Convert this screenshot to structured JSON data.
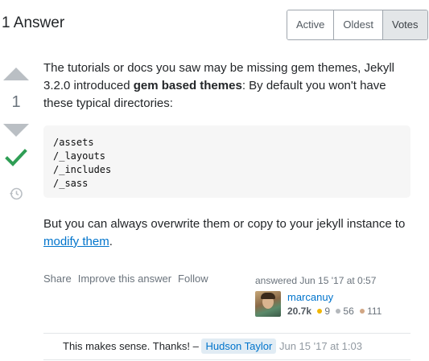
{
  "header": {
    "answer_count": "1 Answer"
  },
  "sort": {
    "active": "Active",
    "oldest": "Oldest",
    "votes": "Votes",
    "selected": "Votes"
  },
  "vote": {
    "score": "1"
  },
  "answer": {
    "para1_a": "The tutorials or docs you saw may be missing gem themes, Jekyll 3.2.0 introduced ",
    "para1_bold": "gem based themes",
    "para1_b": ": By default you won't have these typical directories:",
    "code_lines": [
      "/assets",
      "/_layouts",
      "/_includes",
      "/_sass"
    ],
    "para2_a": "But you can always overwrite them or copy to your jekyll instance to ",
    "para2_link": "modify them",
    "para2_b": "."
  },
  "post_menu": {
    "share": "Share",
    "improve": "Improve this answer",
    "follow": "Follow"
  },
  "user_card": {
    "time": "answered Jun 15 '17 at 0:57",
    "name": "marcanuy",
    "reputation": "20.7k",
    "gold": "9",
    "silver": "56",
    "bronze": "111",
    "colors": {
      "gold": "#f1b600",
      "silver": "#b4b8bc",
      "bronze": "#d1a684"
    }
  },
  "comment": {
    "text": "This makes sense. Thanks! –",
    "user": "Hudson Taylor",
    "date": "Jun 15 '17 at 1:03"
  },
  "icons": {
    "accepted": "check-icon",
    "history": "history-icon"
  },
  "colors": {
    "accepted_green": "#2f9e55",
    "link": "#0074cc"
  }
}
